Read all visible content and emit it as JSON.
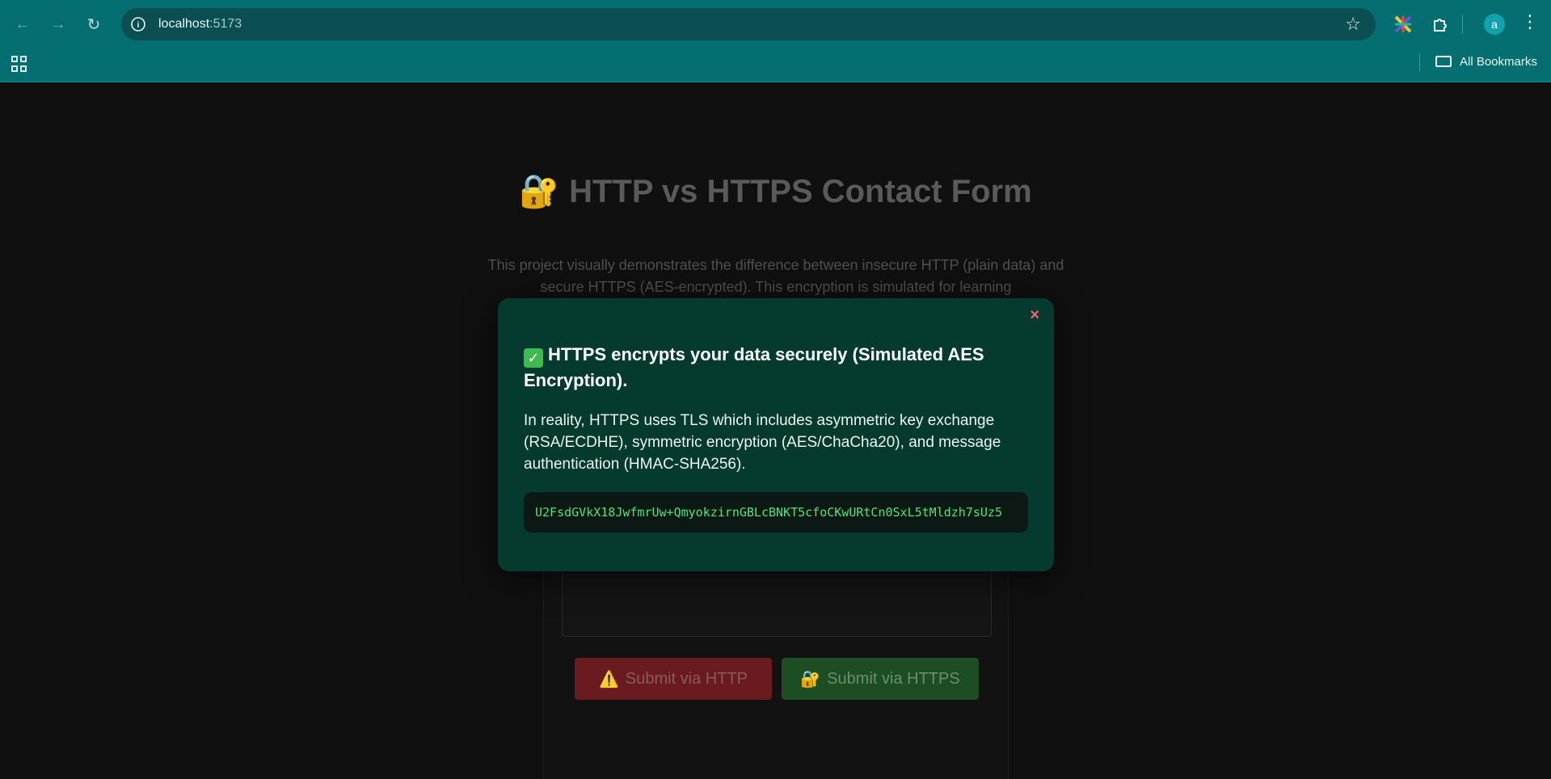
{
  "browser": {
    "url_host": "localhost",
    "url_port": ":5173",
    "bookmarks_label": "All Bookmarks",
    "avatar_letter": "a",
    "icons": {
      "back": "arrow-left-icon",
      "forward": "arrow-right-icon",
      "reload": "reload-icon",
      "site_info": "info-icon",
      "star": "star-icon",
      "extensions": "puzzle-icon",
      "menu": "more-vert-icon",
      "apps": "apps-grid-icon",
      "folder": "folder-icon"
    }
  },
  "page": {
    "title": "HTTP vs HTTPS Contact Form",
    "title_icon": "🔐",
    "description": "This project visually demonstrates the difference between insecure HTTP (plain data) and secure HTTPS (AES-encrypted). This encryption is simulated for learning",
    "buttons": {
      "http_label": "Submit via HTTP",
      "http_icon": "⚠️",
      "https_label": "Submit via HTTPS",
      "https_icon": "🔐"
    }
  },
  "modal": {
    "close_label": "×",
    "heading_icon": "✓",
    "heading": "HTTPS encrypts your data securely (Simulated AES Encryption).",
    "body": "In reality, HTTPS uses TLS which includes asymmetric key exchange (RSA/ECDHE), symmetric encryption (AES/ChaCha20), and message authentication (HMAC-SHA256).",
    "ciphertext": "U2FsdGVkX18JwfmrUw+QmyokzirnGBLcBNKT5cfoCKwURtCn0SxL5tMldzh7sUz5"
  },
  "colors": {
    "chrome": "#046e71",
    "modal_bg": "#053b2f",
    "cipher_text": "#4ee37a",
    "close": "#ff5f7a",
    "http_button": "#6a1b20",
    "https_button": "#1c4d23"
  }
}
